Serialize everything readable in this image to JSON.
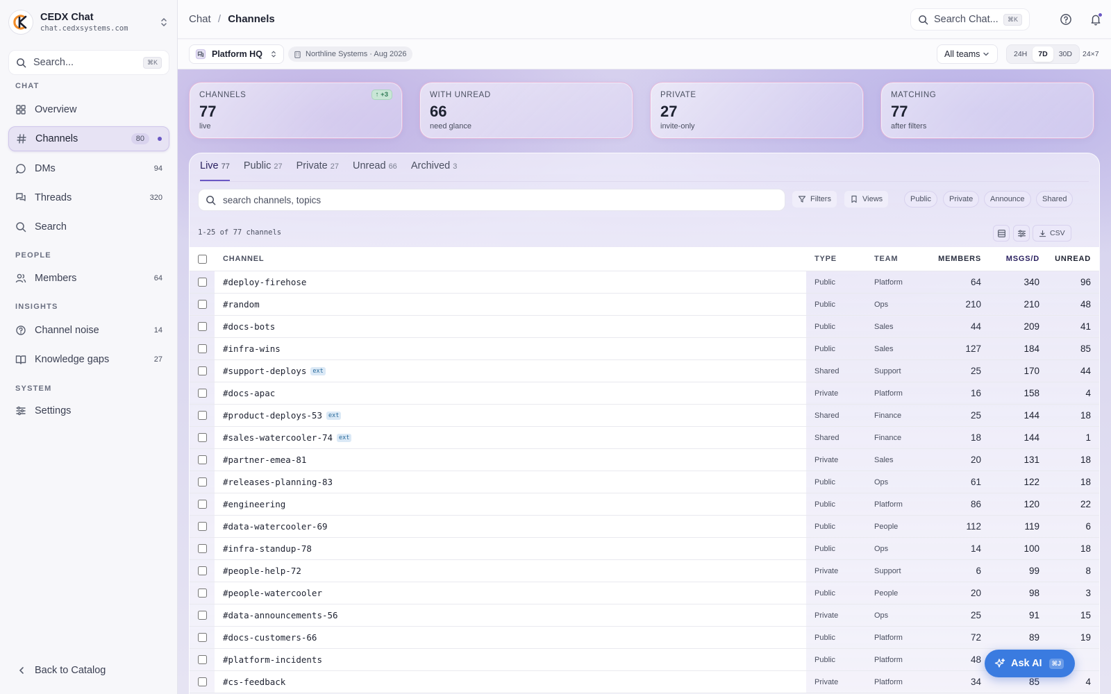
{
  "brand": {
    "name": "CEDX Chat",
    "domain": "chat.cedxsystems.com"
  },
  "sidebar": {
    "search_placeholder": "Search...",
    "search_kbd": "⌘K",
    "sections": {
      "chat": "CHAT",
      "people": "PEOPLE",
      "insights": "INSIGHTS",
      "system": "SYSTEM"
    },
    "items": [
      {
        "label": "Overview",
        "count": ""
      },
      {
        "label": "Channels",
        "count": "80"
      },
      {
        "label": "DMs",
        "count": "94"
      },
      {
        "label": "Threads",
        "count": "320"
      },
      {
        "label": "Search",
        "count": ""
      },
      {
        "label": "Members",
        "count": "64"
      },
      {
        "label": "Channel noise",
        "count": "14"
      },
      {
        "label": "Knowledge gaps",
        "count": "27"
      },
      {
        "label": "Settings",
        "count": ""
      }
    ],
    "back_label": "Back to Catalog"
  },
  "topbar": {
    "breadcrumb_root": "Chat",
    "breadcrumb_sep": "/",
    "breadcrumb_current": "Channels",
    "search_placeholder": "Search Chat...",
    "search_kbd": "⌘K"
  },
  "subbar": {
    "workspace": "Platform HQ",
    "org": "Northline Systems · Aug 2026",
    "teams_select": "All teams",
    "ranges": [
      "24H",
      "7D",
      "30D"
    ],
    "active_range": "7D",
    "range_extra": "24×7"
  },
  "stats": [
    {
      "label": "CHANNELS",
      "value": "77",
      "sub": "live",
      "delta": "↑ +3"
    },
    {
      "label": "WITH UNREAD",
      "value": "66",
      "sub": "need glance",
      "delta": ""
    },
    {
      "label": "PRIVATE",
      "value": "27",
      "sub": "invite-only",
      "delta": ""
    },
    {
      "label": "MATCHING",
      "value": "77",
      "sub": "after filters",
      "delta": ""
    }
  ],
  "tabs": [
    {
      "label": "Live",
      "count": "77"
    },
    {
      "label": "Public",
      "count": "27"
    },
    {
      "label": "Private",
      "count": "27"
    },
    {
      "label": "Unread",
      "count": "66"
    },
    {
      "label": "Archived",
      "count": "3"
    }
  ],
  "toolbar": {
    "search_placeholder": "search channels, topics",
    "filters_label": "Filters",
    "views_label": "Views",
    "chips": [
      "Public",
      "Private",
      "Announce",
      "Shared"
    ],
    "result_count": "1-25 of 77 channels",
    "csv_label": "CSV"
  },
  "table": {
    "headers": {
      "channel": "CHANNEL",
      "type": "TYPE",
      "team": "TEAM",
      "members": "MEMBERS",
      "msgs": "MSGS/D",
      "unread": "UNREAD"
    },
    "ext_label": "ext",
    "rows": [
      {
        "name": "#deploy-firehose",
        "ext": false,
        "type": "Public",
        "team": "Platform",
        "members": "64",
        "msgs": "340",
        "unread": "96"
      },
      {
        "name": "#random",
        "ext": false,
        "type": "Public",
        "team": "Ops",
        "members": "210",
        "msgs": "210",
        "unread": "48"
      },
      {
        "name": "#docs-bots",
        "ext": false,
        "type": "Public",
        "team": "Sales",
        "members": "44",
        "msgs": "209",
        "unread": "41"
      },
      {
        "name": "#infra-wins",
        "ext": false,
        "type": "Public",
        "team": "Sales",
        "members": "127",
        "msgs": "184",
        "unread": "85"
      },
      {
        "name": "#support-deploys",
        "ext": true,
        "type": "Shared",
        "team": "Support",
        "members": "25",
        "msgs": "170",
        "unread": "44"
      },
      {
        "name": "#docs-apac",
        "ext": false,
        "type": "Private",
        "team": "Platform",
        "members": "16",
        "msgs": "158",
        "unread": "4"
      },
      {
        "name": "#product-deploys-53",
        "ext": true,
        "type": "Shared",
        "team": "Finance",
        "members": "25",
        "msgs": "144",
        "unread": "18"
      },
      {
        "name": "#sales-watercooler-74",
        "ext": true,
        "type": "Shared",
        "team": "Finance",
        "members": "18",
        "msgs": "144",
        "unread": "1"
      },
      {
        "name": "#partner-emea-81",
        "ext": false,
        "type": "Private",
        "team": "Sales",
        "members": "20",
        "msgs": "131",
        "unread": "18"
      },
      {
        "name": "#releases-planning-83",
        "ext": false,
        "type": "Public",
        "team": "Ops",
        "members": "61",
        "msgs": "122",
        "unread": "18"
      },
      {
        "name": "#engineering",
        "ext": false,
        "type": "Public",
        "team": "Platform",
        "members": "86",
        "msgs": "120",
        "unread": "22"
      },
      {
        "name": "#data-watercooler-69",
        "ext": false,
        "type": "Public",
        "team": "People",
        "members": "112",
        "msgs": "119",
        "unread": "6"
      },
      {
        "name": "#infra-standup-78",
        "ext": false,
        "type": "Public",
        "team": "Ops",
        "members": "14",
        "msgs": "100",
        "unread": "18"
      },
      {
        "name": "#people-help-72",
        "ext": false,
        "type": "Private",
        "team": "Support",
        "members": "6",
        "msgs": "99",
        "unread": "8"
      },
      {
        "name": "#people-watercooler",
        "ext": false,
        "type": "Public",
        "team": "People",
        "members": "20",
        "msgs": "98",
        "unread": "3"
      },
      {
        "name": "#data-announcements-56",
        "ext": false,
        "type": "Private",
        "team": "Ops",
        "members": "25",
        "msgs": "91",
        "unread": "15"
      },
      {
        "name": "#docs-customers-66",
        "ext": false,
        "type": "Public",
        "team": "Platform",
        "members": "72",
        "msgs": "89",
        "unread": "19"
      },
      {
        "name": "#platform-incidents",
        "ext": false,
        "type": "Public",
        "team": "Platform",
        "members": "48",
        "msgs": "",
        "unread": ""
      },
      {
        "name": "#cs-feedback",
        "ext": false,
        "type": "Private",
        "team": "Platform",
        "members": "34",
        "msgs": "85",
        "unread": "4"
      }
    ]
  },
  "ask_ai": {
    "label": "Ask AI",
    "kbd": "⌘J"
  }
}
